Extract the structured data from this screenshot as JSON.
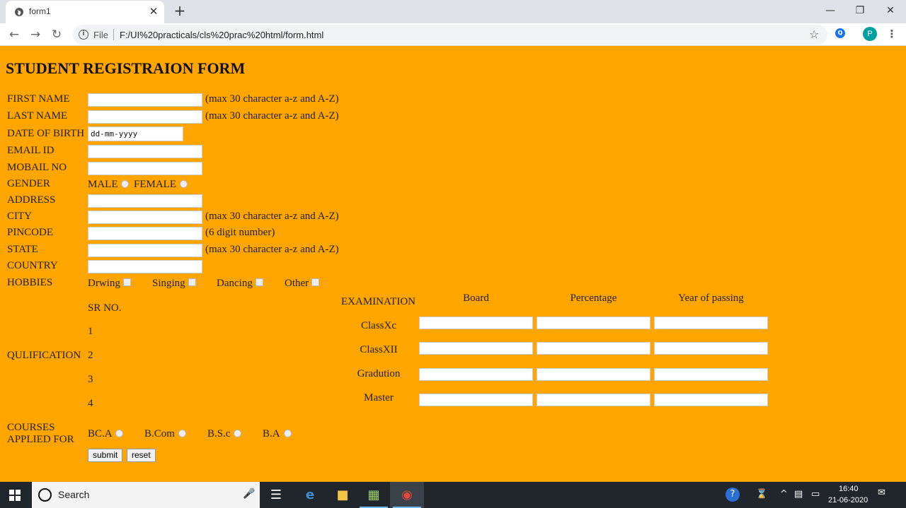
{
  "browser": {
    "tab_title": "form1",
    "tab_close": "✕",
    "new_tab": "+",
    "url_scheme": "File",
    "url": "F:/UI%20practicals/cls%20prac%20html/form.html",
    "profile_initial": "P",
    "icons": [
      "globe-icon",
      "back-arrow-icon",
      "forward-arrow-icon",
      "reload-icon",
      "info-icon",
      "star-icon",
      "extension-icon",
      "menu-dots-icon",
      "minimize-icon",
      "restore-icon",
      "close-icon"
    ]
  },
  "form": {
    "title": "STUDENT REGISTRAION FORM",
    "first_name": {
      "label": "FIRST NAME",
      "hint": "(max 30 character a-z and A-Z)"
    },
    "last_name": {
      "label": "LAST NAME",
      "hint": "(max 30 character a-z and A-Z)"
    },
    "dob": {
      "label": "DATE OF BIRTH",
      "placeholder": "dd-mm-yyyy"
    },
    "email": {
      "label": "EMAIL ID"
    },
    "mobile": {
      "label": "MOBAIL NO"
    },
    "gender": {
      "label": "GENDER",
      "options": [
        "MALE",
        "FEMALE"
      ]
    },
    "address": {
      "label": "ADDRESS"
    },
    "city": {
      "label": "CITY",
      "hint": "(max 30 character a-z and A-Z)"
    },
    "pincode": {
      "label": "PINCODE",
      "hint": "(6 digit number)"
    },
    "state": {
      "label": "STATE",
      "hint": "(max 30 character a-z and A-Z)"
    },
    "country": {
      "label": "COUNTRY"
    },
    "hobbies": {
      "label": "HOBBIES",
      "options": [
        "Drwing",
        "Singing",
        "Dancing",
        "Other"
      ]
    },
    "qualification": {
      "label": "QULIFICATION",
      "sr_header": "SR NO.",
      "sr_numbers": [
        "1",
        "2",
        "3",
        "4"
      ],
      "headers": [
        "EXAMINATION",
        "Board",
        "Percentage",
        "Year of passing"
      ],
      "exams": [
        "ClassXc",
        "ClassXII",
        "Gradution",
        "Master"
      ]
    },
    "courses": {
      "label_line1": "COURSES",
      "label_line2": "APPLIED FOR",
      "options": [
        "BC.A",
        "B.Com",
        "B.S.c",
        "B.A"
      ]
    },
    "submit_label": "submit",
    "reset_label": "reset"
  },
  "taskbar": {
    "search_placeholder": "Search",
    "time": "16:40",
    "date": "21-06-2020",
    "apps": [
      "task-view-icon",
      "edge-icon",
      "file-explorer-icon",
      "notepad-icon",
      "chrome-icon"
    ]
  }
}
